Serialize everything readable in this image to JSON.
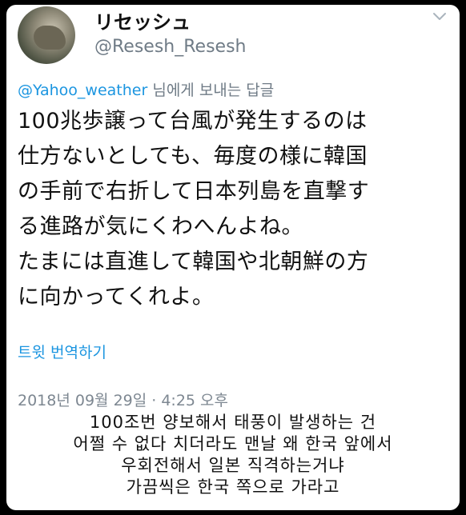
{
  "tweet": {
    "display_name": "リセッシュ",
    "handle": "@Resesh_Resesh",
    "avatar_icon": "user-avatar-photo",
    "menu_icon": "chevron-down-icon",
    "reply_to_mention": "@Yahoo_weather",
    "reply_to_suffix": " 님에게 보내는 답글",
    "text": "100兆歩譲って台風が発生するのは\n仕方ないとしても、毎度の様に韓国\nの手前で右折して日本列島を直撃す\nる進路が気にくわへんよね。\nたまには直進して韓国や北朝鮮の方\nに向かってくれよ。",
    "translate_label": "트윗 번역하기",
    "timestamp": "2018년 09월 29일 · 4:25 오후"
  },
  "caption": {
    "text": "100조번 양보해서 태풍이 발생하는 건\n어쩔 수 없다 치더라도 맨날 왜 한국 앞에서\n우회전해서 일본 직격하는거냐\n가끔씩은 한국 쪽으로 가라고"
  },
  "colors": {
    "link": "#1b95e0",
    "secondary_text": "#6f7b86",
    "background_frame": "#000000"
  }
}
